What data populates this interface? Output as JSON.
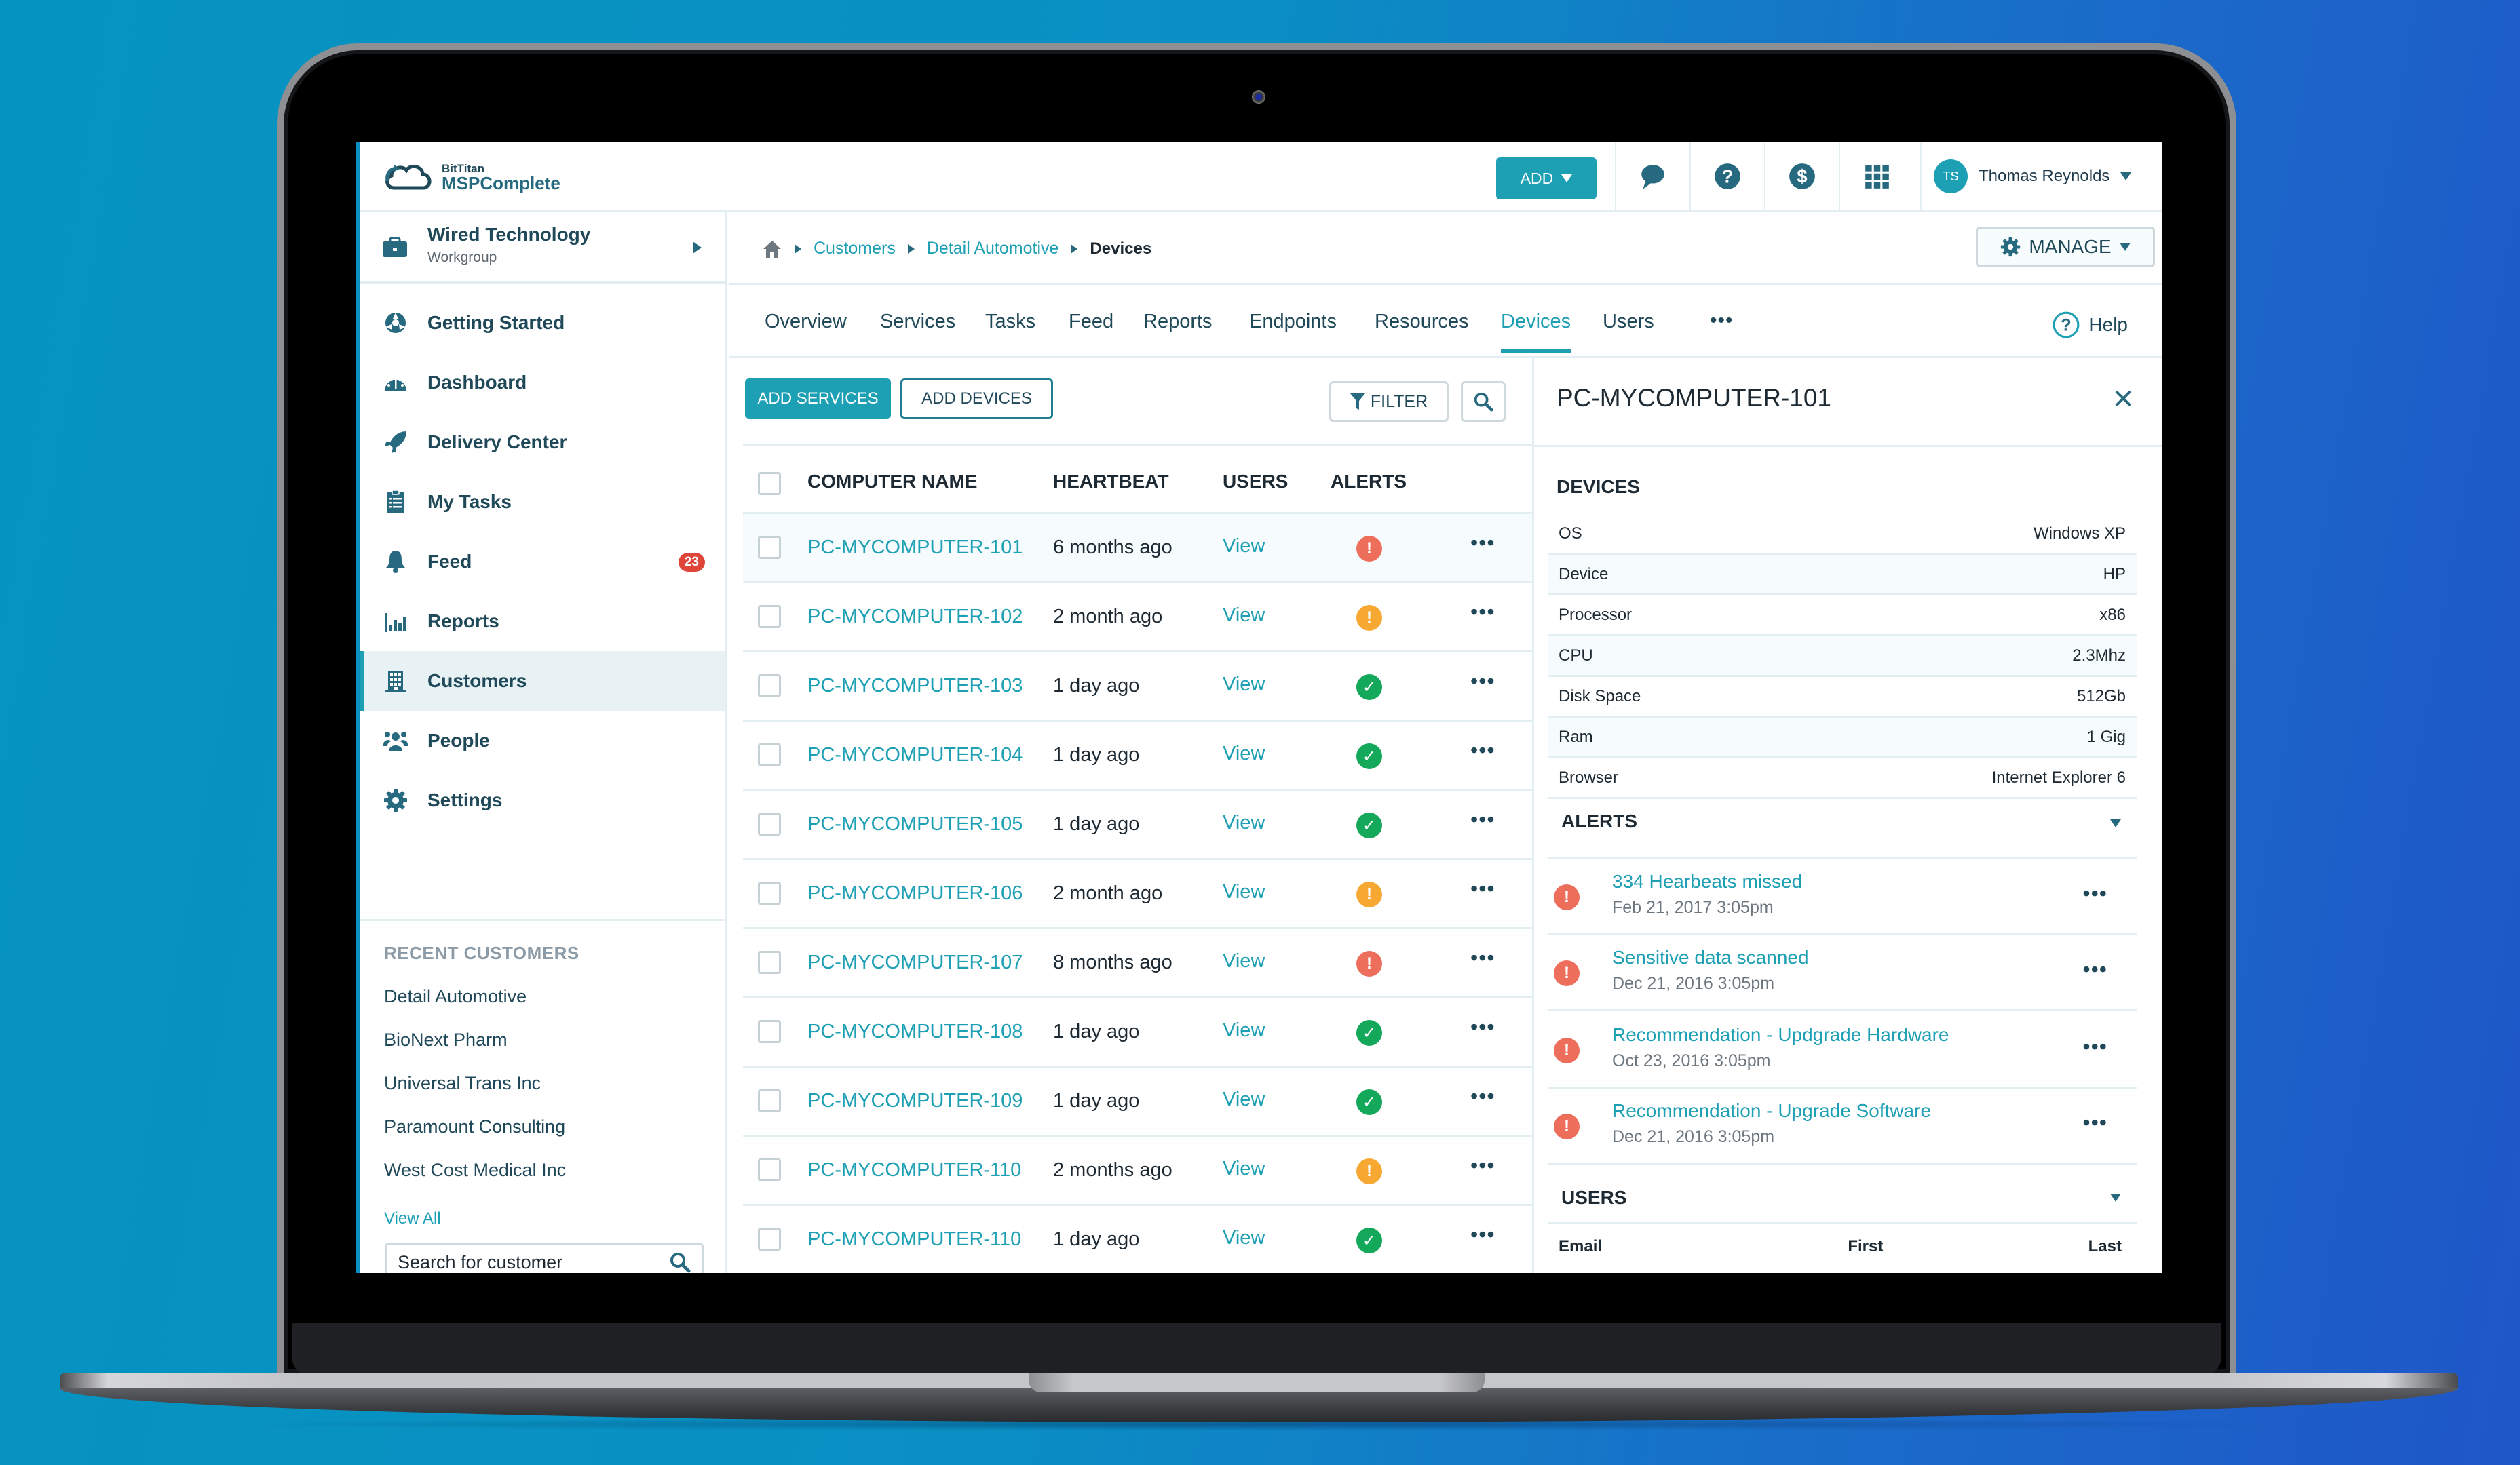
{
  "app": {
    "brand_line1": "BitTitan",
    "brand_line2": "MSPComplete",
    "add_button": "ADD",
    "toolbar_icons": [
      "chat-icon",
      "help-icon",
      "billing-icon",
      "apps-grid-icon"
    ],
    "user": {
      "initials": "TS",
      "name": "Thomas Reynolds"
    }
  },
  "sidebar": {
    "workgroup": {
      "name": "Wired Technology",
      "type": "Workgroup"
    },
    "items": [
      {
        "label": "Getting Started",
        "icon": "getting-started-icon"
      },
      {
        "label": "Dashboard",
        "icon": "dashboard-icon"
      },
      {
        "label": "Delivery Center",
        "icon": "rocket-icon"
      },
      {
        "label": "My Tasks",
        "icon": "clipboard-icon"
      },
      {
        "label": "Feed",
        "icon": "bell-icon",
        "badge": "23"
      },
      {
        "label": "Reports",
        "icon": "bar-chart-icon"
      },
      {
        "label": "Customers",
        "icon": "building-icon",
        "active": true
      },
      {
        "label": "People",
        "icon": "people-icon"
      },
      {
        "label": "Settings",
        "icon": "gear-icon"
      }
    ],
    "recent_title": "RECENT CUSTOMERS",
    "recent": [
      "Detail Automotive",
      "BioNext Pharm",
      "Universal Trans Inc",
      "Paramount Consulting",
      "West Cost Medical Inc"
    ],
    "view_all": "View All",
    "search_placeholder": "Search for customer"
  },
  "breadcrumb": {
    "items": [
      "Customers",
      "Detail Automotive"
    ],
    "current": "Devices",
    "manage_button": "MANAGE"
  },
  "tabs": {
    "items": [
      "Overview",
      "Services",
      "Tasks",
      "Feed",
      "Reports",
      "Endpoints",
      "Resources",
      "Devices",
      "Users"
    ],
    "active": "Devices",
    "more": "•••",
    "help": "Help"
  },
  "devices": {
    "add_services": "ADD SERVICES",
    "add_devices": "ADD DEVICES",
    "filter": "FILTER",
    "columns": [
      "COMPUTER NAME",
      "HEARTBEAT",
      "USERS",
      "ALERTS"
    ],
    "rows": [
      {
        "name": "PC-MYCOMPUTER-101",
        "heartbeat": "6 months ago",
        "users": "View",
        "alert": "critical"
      },
      {
        "name": "PC-MYCOMPUTER-102",
        "heartbeat": "2 month ago",
        "users": "View",
        "alert": "warning"
      },
      {
        "name": "PC-MYCOMPUTER-103",
        "heartbeat": "1 day ago",
        "users": "View",
        "alert": "ok"
      },
      {
        "name": "PC-MYCOMPUTER-104",
        "heartbeat": "1 day ago",
        "users": "View",
        "alert": "ok"
      },
      {
        "name": "PC-MYCOMPUTER-105",
        "heartbeat": "1 day ago",
        "users": "View",
        "alert": "ok"
      },
      {
        "name": "PC-MYCOMPUTER-106",
        "heartbeat": "2 month ago",
        "users": "View",
        "alert": "warning"
      },
      {
        "name": "PC-MYCOMPUTER-107",
        "heartbeat": "8 months ago",
        "users": "View",
        "alert": "critical"
      },
      {
        "name": "PC-MYCOMPUTER-108",
        "heartbeat": "1 day ago",
        "users": "View",
        "alert": "ok"
      },
      {
        "name": "PC-MYCOMPUTER-109",
        "heartbeat": "1 day ago",
        "users": "View",
        "alert": "ok"
      },
      {
        "name": "PC-MYCOMPUTER-110",
        "heartbeat": "2 months ago",
        "users": "View",
        "alert": "warning"
      },
      {
        "name": "PC-MYCOMPUTER-110",
        "heartbeat": "1 day ago",
        "users": "View",
        "alert": "ok"
      }
    ],
    "more": "•••"
  },
  "alert_colors": {
    "critical": "#ee6e5c",
    "warning": "#f7a833",
    "ok": "#13a85a"
  },
  "detail": {
    "title": "PC-MYCOMPUTER-101",
    "close": "✕",
    "devices_title": "DEVICES",
    "properties": [
      {
        "key": "OS",
        "value": "Windows XP"
      },
      {
        "key": "Device",
        "value": "HP"
      },
      {
        "key": "Processor",
        "value": "x86"
      },
      {
        "key": "CPU",
        "value": "2.3Mhz"
      },
      {
        "key": "Disk Space",
        "value": "512Gb"
      },
      {
        "key": "Ram",
        "value": "1 Gig"
      },
      {
        "key": "Browser",
        "value": "Internet Explorer 6"
      }
    ],
    "alerts_title": "ALERTS",
    "alerts": [
      {
        "title": "334 Hearbeats missed",
        "time": "Feb 21, 2017 3:05pm"
      },
      {
        "title": "Sensitive data scanned",
        "time": "Dec 21, 2016 3:05pm"
      },
      {
        "title": "Recommendation - Updgrade Hardware",
        "time": "Oct 23, 2016 3:05pm"
      },
      {
        "title": "Recommendation - Upgrade Software",
        "time": "Dec 21, 2016 3:05pm"
      }
    ],
    "users_title": "USERS",
    "users_columns": [
      "Email",
      "First",
      "Last"
    ]
  },
  "colors": {
    "accent": "#1d9fb4",
    "navy": "#1f4858",
    "badge": "#e0453a"
  }
}
